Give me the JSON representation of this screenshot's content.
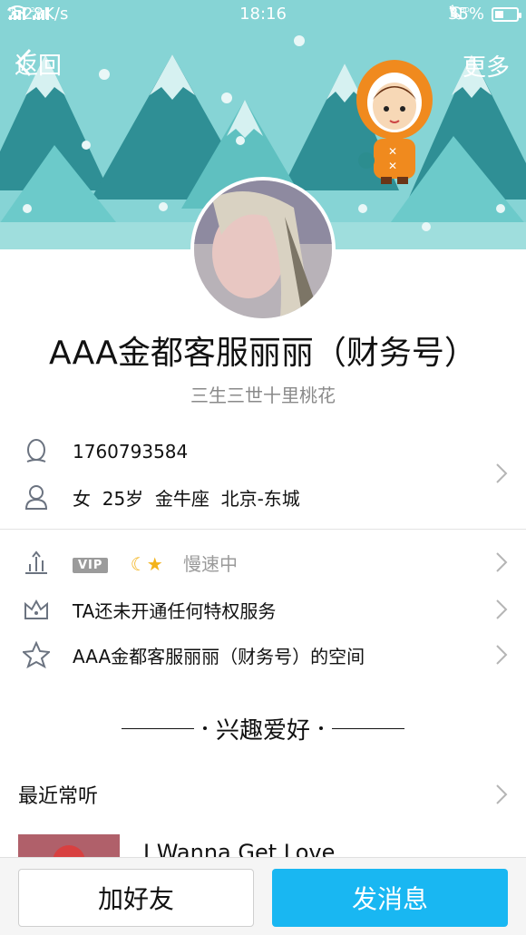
{
  "status_bar": {
    "network_speed": "2.28K/s",
    "time": "18:16",
    "battery": "35%",
    "battery_level": 0.35
  },
  "nav": {
    "back_label": "返回",
    "more_label": "更多"
  },
  "profile": {
    "name": "AAA金都客服丽丽（财务号）",
    "signature": "三生三世十里桃花",
    "qq_number": "1760793584",
    "details": "女  25岁  金牛座  北京-东城"
  },
  "privileges": {
    "vip_badge": "VIP",
    "level_status": "慢速中",
    "service_text": "TA还未开通任何特权服务",
    "space_text": "AAA金都客服丽丽（财务号）的空间"
  },
  "hobbies": {
    "title": "兴趣爱好"
  },
  "recent": {
    "label": "最近常听",
    "song_title": "I Wanna Get Love"
  },
  "actions": {
    "add_friend": "加好友",
    "send_message": "发消息"
  },
  "colors": {
    "banner": "#7fd3d6",
    "primary_button": "#19b7f2"
  }
}
